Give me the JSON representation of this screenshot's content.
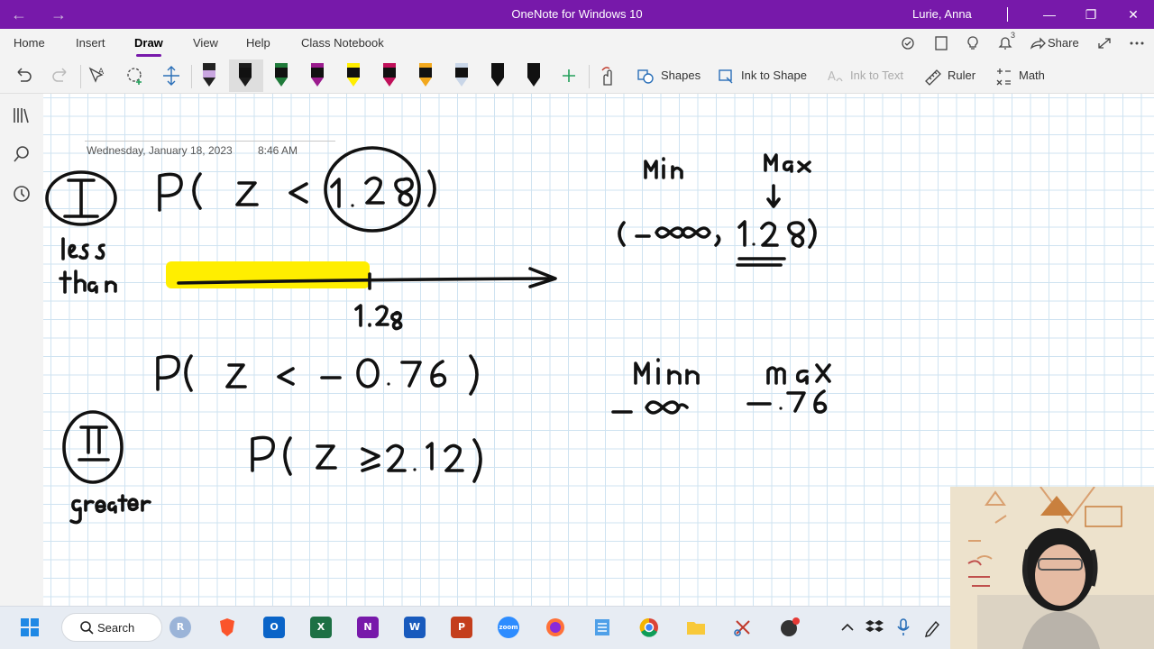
{
  "window": {
    "title": "OneNote for Windows 10",
    "user": "Lurie, Anna",
    "back_icon": "back-arrow-icon",
    "forward_icon": "forward-arrow-icon",
    "minimize": "—",
    "restore": "❐",
    "close": "✕"
  },
  "ribbon": {
    "tabs": [
      "Home",
      "Insert",
      "Draw",
      "View",
      "Help",
      "Class Notebook"
    ],
    "active_tab": "Draw",
    "share_label": "Share",
    "notification_count": "3"
  },
  "toolbar": {
    "shapes_label": "Shapes",
    "ink_to_shape_label": "Ink to Shape",
    "ink_to_text_label": "Ink to Text",
    "ruler_label": "Ruler",
    "math_label": "Math",
    "pen_colors": [
      "#222222",
      "#1a1a1a",
      "#1f7a3a",
      "#9b1b8e",
      "#ffee00",
      "#c0105a",
      "#f2a81d",
      "#c9d6e8",
      "#111111",
      "#111111"
    ]
  },
  "page": {
    "date": "Wednesday, January 18, 2023",
    "time": "8:46 AM"
  },
  "ink_text": {
    "less": "less",
    "than": "than",
    "tick_value": "1.28",
    "greater": "greater",
    "min1": "Min",
    "max1": "Max",
    "min2": "Min",
    "max2": "Max",
    "neg76": "-.76"
  },
  "taskbar": {
    "search_label": "Search"
  },
  "colors": {
    "title_bar": "#7719aa",
    "highlighter": "#ffee00",
    "grid": "#cfe3f1"
  }
}
